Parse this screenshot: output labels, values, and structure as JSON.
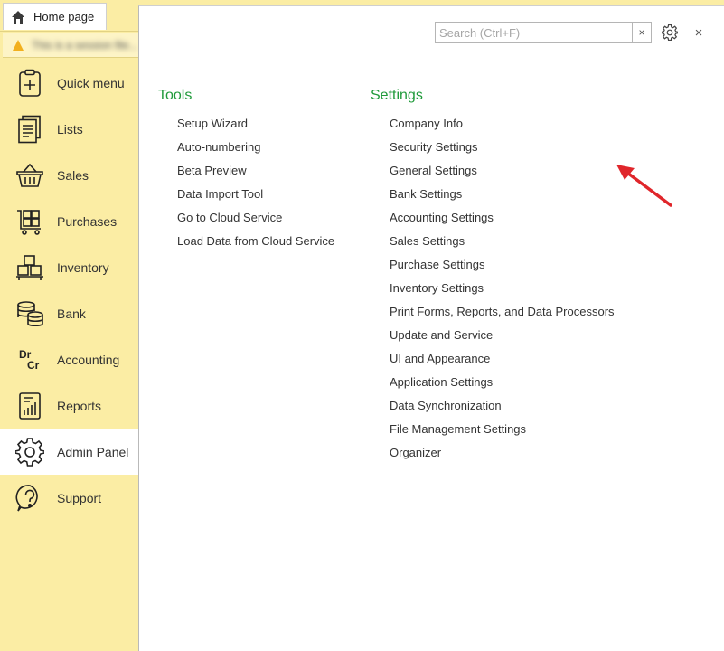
{
  "tab": {
    "home_label": "Home page",
    "icon": "home-icon"
  },
  "notice": {
    "text": "This is a session file...",
    "icon": "warning-icon"
  },
  "sidebar": {
    "items": [
      {
        "label": "Quick menu",
        "icon": "clipboard-plus-icon"
      },
      {
        "label": "Lists",
        "icon": "document-list-icon"
      },
      {
        "label": "Sales",
        "icon": "basket-icon"
      },
      {
        "label": "Purchases",
        "icon": "cart-boxes-icon"
      },
      {
        "label": "Inventory",
        "icon": "boxes-icon"
      },
      {
        "label": "Bank",
        "icon": "coins-icon"
      },
      {
        "label": "Accounting",
        "icon": "dr-cr-icon"
      },
      {
        "label": "Reports",
        "icon": "report-chart-icon"
      },
      {
        "label": "Admin Panel",
        "icon": "gear-icon",
        "active": true
      },
      {
        "label": "Support",
        "icon": "help-icon"
      }
    ]
  },
  "search": {
    "placeholder": "Search (Ctrl+F)",
    "value": "",
    "clear": "×"
  },
  "panel": {
    "close": "×"
  },
  "tools": {
    "title": "Tools",
    "items": [
      "Setup Wizard",
      "Auto-numbering",
      "Beta Preview",
      "Data Import Tool",
      "Go to Cloud Service",
      "Load Data from Cloud Service"
    ]
  },
  "settings": {
    "title": "Settings",
    "items": [
      "Company Info",
      "Security Settings",
      "General Settings",
      "Bank Settings",
      "Accounting Settings",
      "Sales Settings",
      "Purchase Settings",
      "Inventory Settings",
      "Print Forms, Reports, and Data Processors",
      "Update and Service",
      "UI and Appearance",
      "Application Settings",
      "Data Synchronization",
      "File Management Settings",
      "Organizer"
    ]
  },
  "colors": {
    "sidebar_bg": "#fbeda4",
    "accent_green": "#1f9a3a",
    "arrow_red": "#e0262b"
  }
}
